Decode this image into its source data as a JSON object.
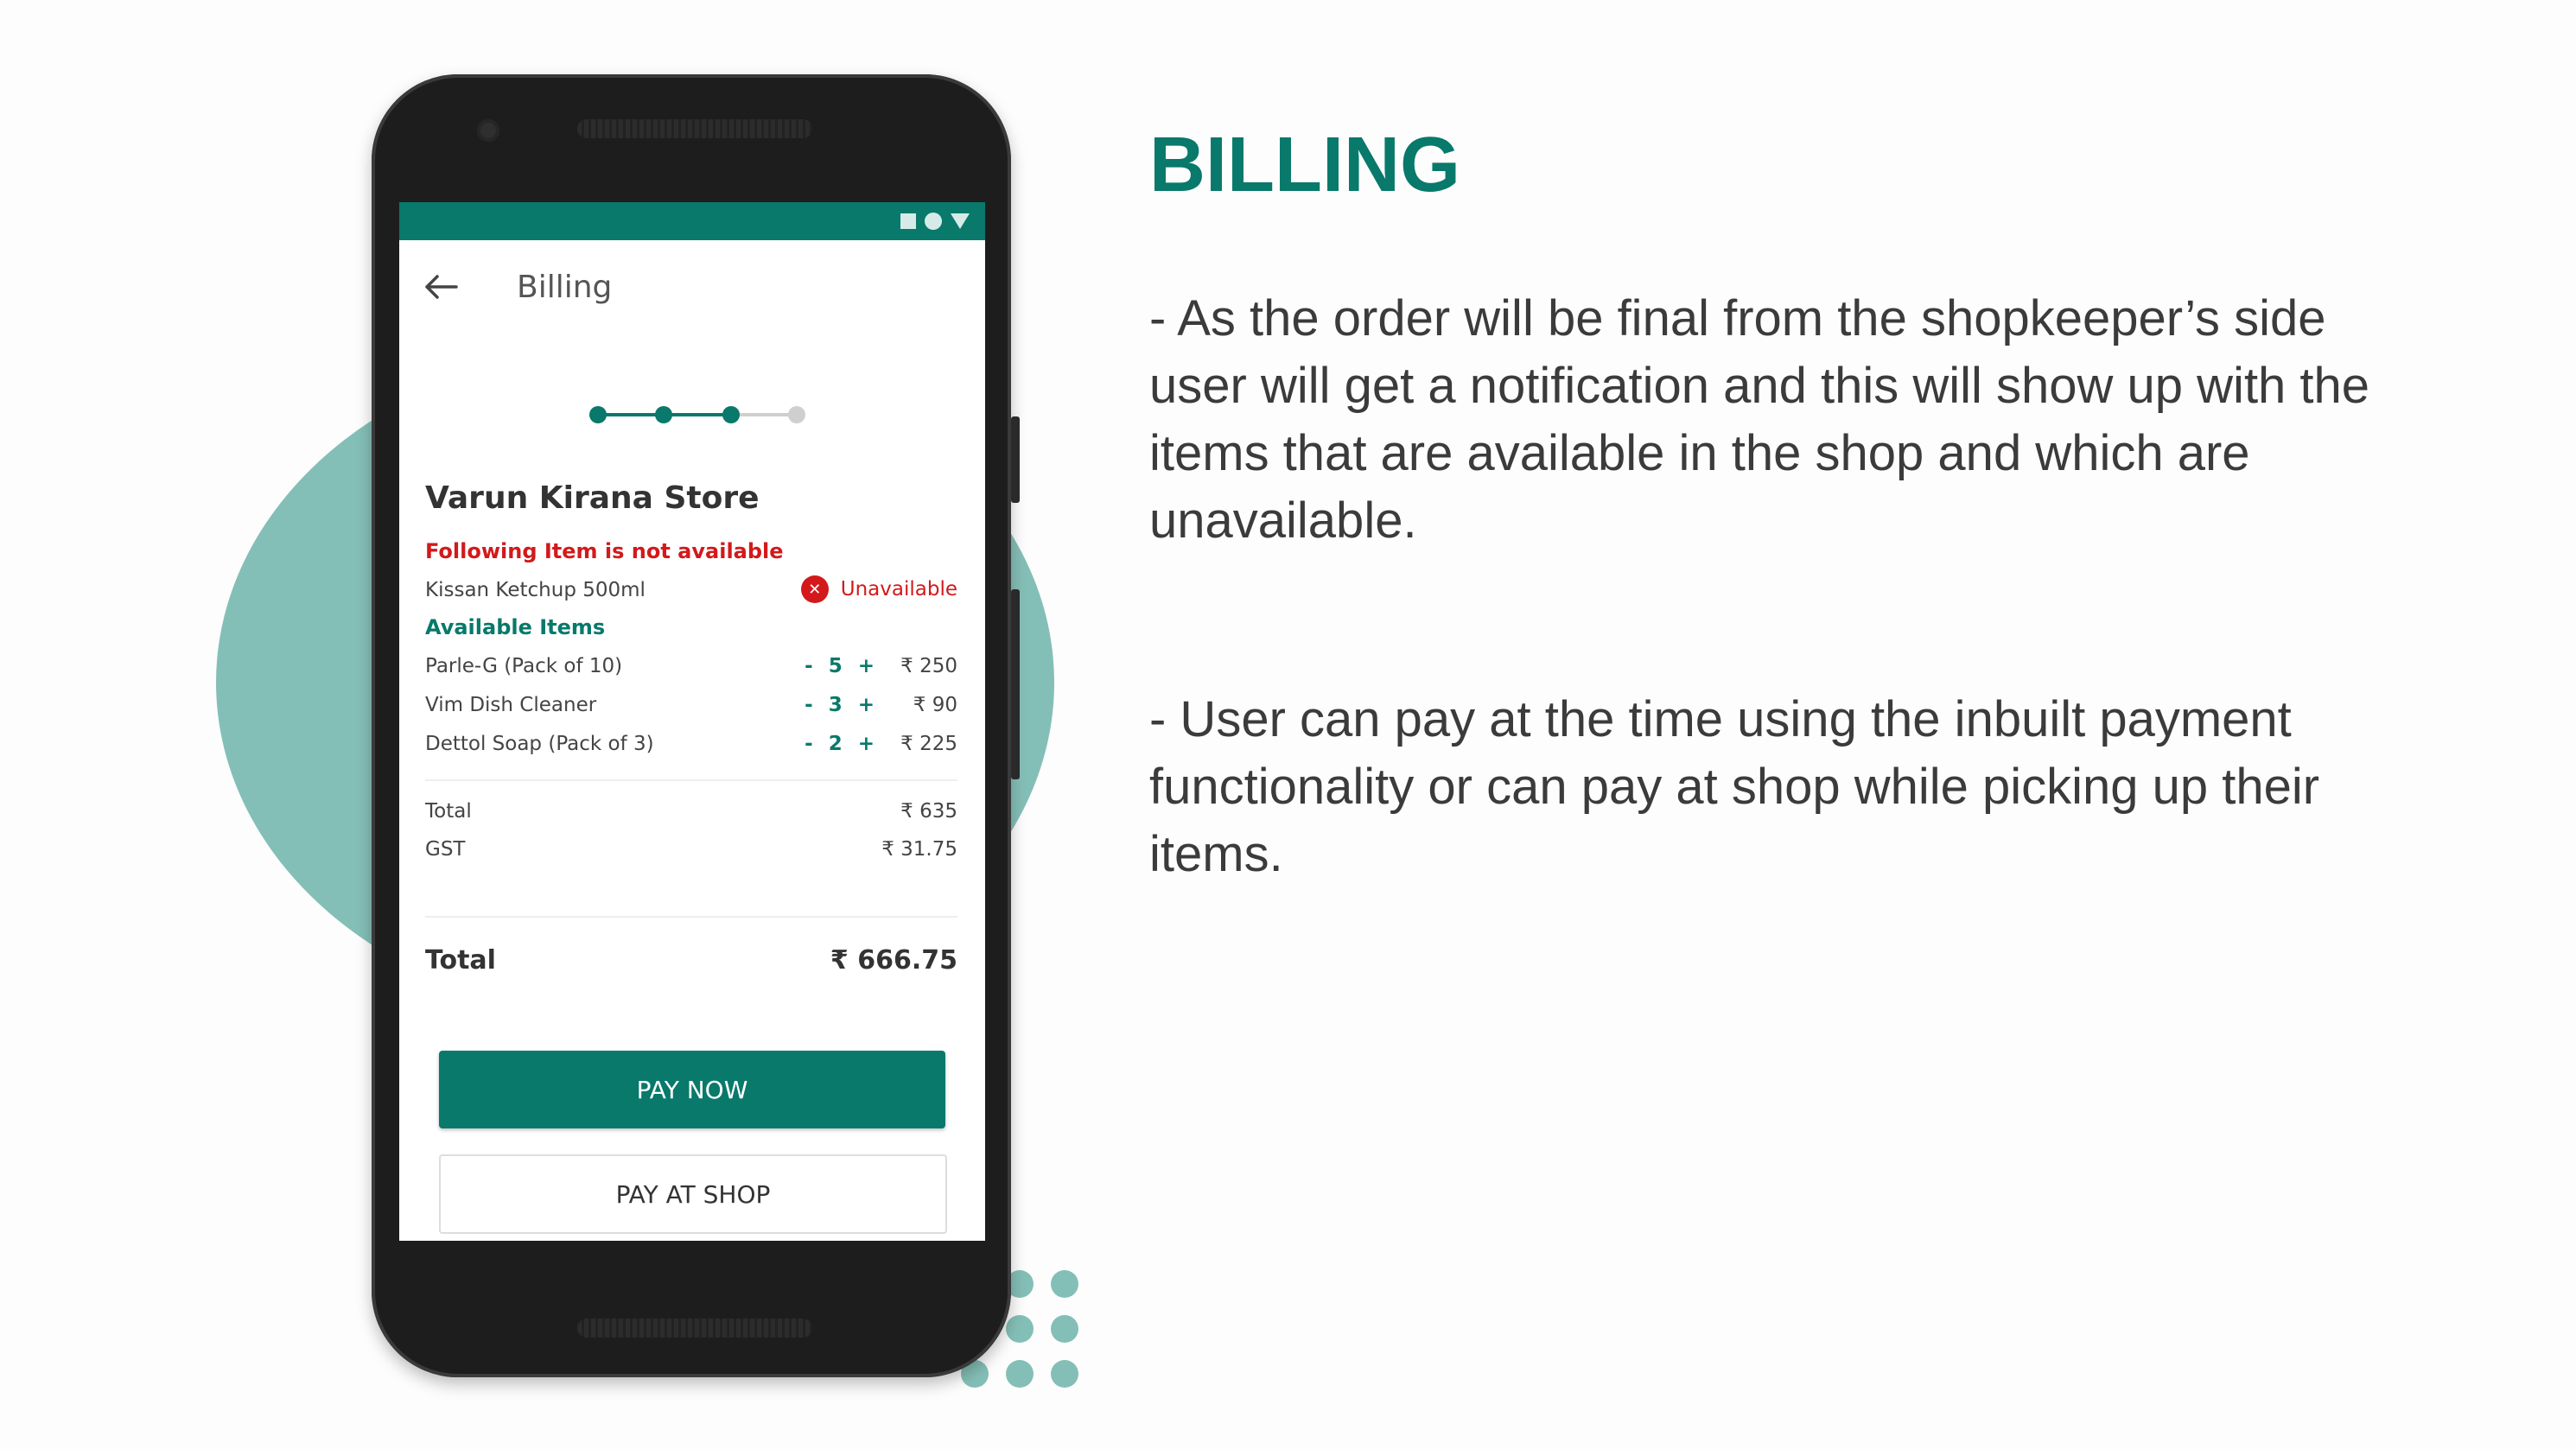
{
  "slide": {
    "heading": "BILLING",
    "paragraph_1": "- As the order will be final from the shopkeeper’s side user will get a notification and this will show up with the items that are available in the shop and which are unavailable.",
    "paragraph_2": "- User can pay at the time using the inbuilt payment functionality or can pay at shop while picking up their items."
  },
  "colors": {
    "accent": "#08796b",
    "decor": "#84bfb7",
    "error": "#d3191b"
  },
  "app": {
    "title": "Billing",
    "back_icon": "arrow-left-icon",
    "stepper": {
      "total_steps": 4,
      "completed_steps": 3
    },
    "store_name": "Varun Kirana Store",
    "unavailable_notice": "Following Item is not available",
    "unavailable_items": [
      {
        "name": "Kissan Ketchup 500ml",
        "status": "Unavailable",
        "icon": "x-circle-icon"
      }
    ],
    "available_label": "Available Items",
    "available_items": [
      {
        "name": "Parle-G (Pack of 10)",
        "minus": "-",
        "qty": "5",
        "plus": "+",
        "price": "₹ 250"
      },
      {
        "name": "Vim Dish Cleaner",
        "minus": "-",
        "qty": "3",
        "plus": "+",
        "price": "₹ 90"
      },
      {
        "name": "Dettol Soap (Pack of 3)",
        "minus": "-",
        "qty": "2",
        "plus": "+",
        "price": "₹ 225"
      }
    ],
    "subtotal_label": "Total",
    "subtotal_value": "₹ 635",
    "gst_label": "GST",
    "gst_value": "₹ 31.75",
    "grand_total_label": "Total",
    "grand_total_value": "₹ 666.75",
    "pay_now_label": "PAY NOW",
    "pay_at_shop_label": "PAY AT SHOP"
  }
}
